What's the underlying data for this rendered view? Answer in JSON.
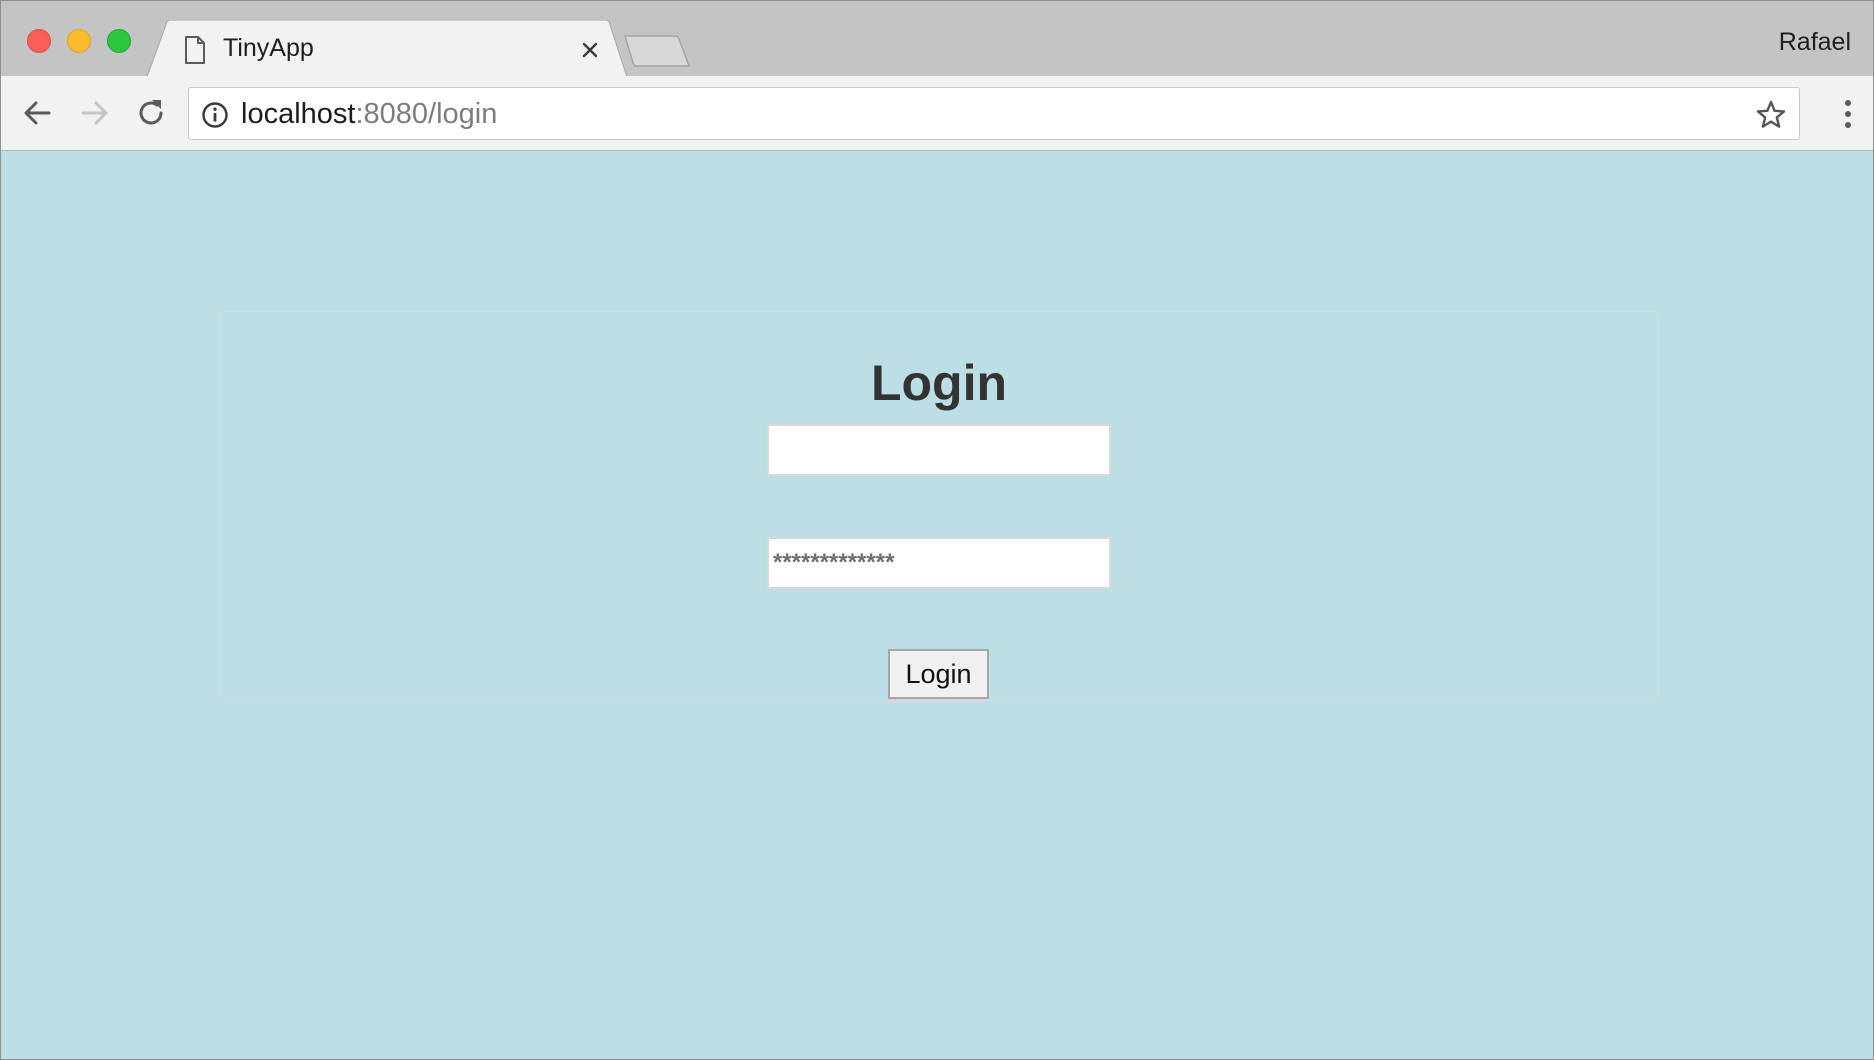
{
  "browser": {
    "tab": {
      "title": "TinyApp",
      "icon": "document-icon"
    },
    "profile_name": "Rafael",
    "url": {
      "host": "localhost",
      "rest": ":8080/login"
    }
  },
  "page": {
    "heading": "Login",
    "email_field": {
      "value": "",
      "placeholder": ""
    },
    "password_field": {
      "value": "*************"
    },
    "submit_label": "Login",
    "background_color": "#bbdfe4"
  }
}
